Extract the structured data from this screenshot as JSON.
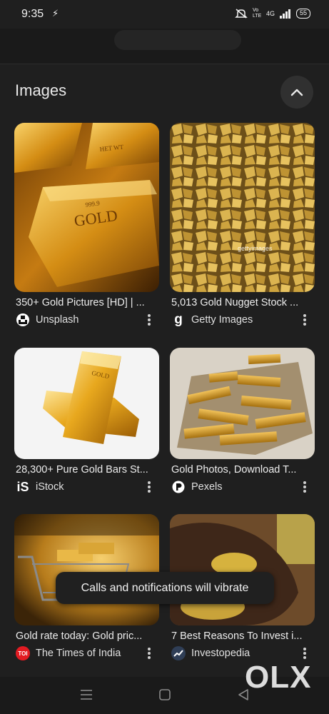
{
  "status": {
    "time": "9:35",
    "network": "4G",
    "volte": "Vo LTE",
    "battery": "55"
  },
  "section": {
    "title": "Images"
  },
  "results": [
    {
      "caption": "350+ Gold Pictures [HD] | ...",
      "source": "Unsplash"
    },
    {
      "caption": "5,013 Gold Nugget Stock ...",
      "source": "Getty Images",
      "overlay": "gettyimages"
    },
    {
      "caption": "28,300+ Pure Gold Bars St...",
      "source": "iStock"
    },
    {
      "caption": "Gold Photos, Download T...",
      "source": "Pexels"
    },
    {
      "caption": "Gold rate today: Gold pric...",
      "source": "The Times of India"
    },
    {
      "caption": "7 Best Reasons To Invest i...",
      "source": "Investopedia"
    }
  ],
  "toast": {
    "text": "Calls and notifications will vibrate"
  },
  "watermark": "OLX",
  "colors": {
    "background": "#1f1f1f",
    "gold": "#d4a019"
  }
}
